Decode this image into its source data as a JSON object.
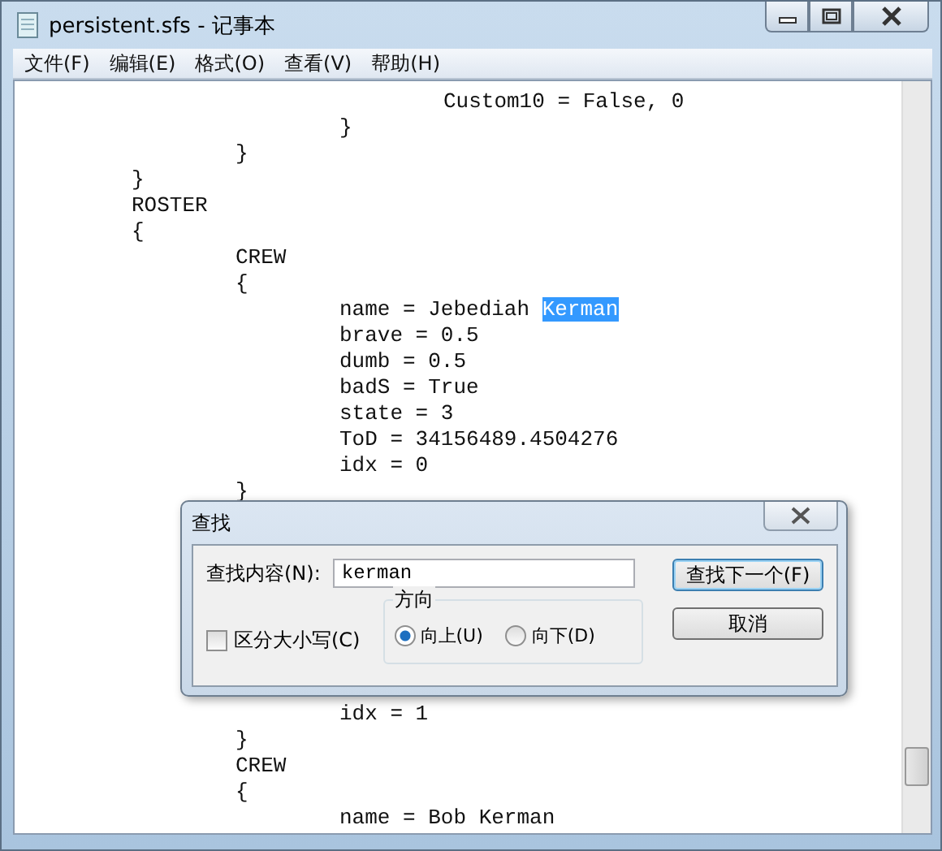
{
  "window": {
    "title": "persistent.sfs - 记事本"
  },
  "menu": [
    {
      "label": "文件(F)"
    },
    {
      "label": "编辑(E)"
    },
    {
      "label": "格式(O)"
    },
    {
      "label": "查看(V)"
    },
    {
      "label": "帮助(H)"
    }
  ],
  "editor": {
    "lines_top": [
      {
        "children": [
          {
            "children": [
              {
                "children": [
                  {
                    "text": "Custom10 = False, 0"
                  }
                ]
              },
              {
                "text": "}"
              }
            ]
          },
          {
            "text": "}"
          }
        ]
      },
      {
        "text": "}"
      },
      {
        "text": "ROSTER"
      },
      {
        "text": "{"
      },
      {
        "children": [
          {
            "text": "CREW"
          },
          {
            "text": "{"
          },
          {
            "children": [
              {
                "text": "name = Jebediah ",
                "selection": "Kerman"
              },
              {
                "text": "brave = 0.5"
              },
              {
                "text": "dumb = 0.5"
              },
              {
                "text": "badS = True"
              },
              {
                "text": "state = 3"
              },
              {
                "text": "ToD = 34156489.4504276"
              },
              {
                "text": "idx = 0"
              }
            ]
          },
          {
            "text": "}"
          }
        ]
      }
    ],
    "lines_bottom": [
      {
        "children": [
          {
            "children": [
              {
                "text": "idx = 1"
              }
            ]
          },
          {
            "text": "}"
          },
          {
            "text": "CREW"
          },
          {
            "text": "{"
          },
          {
            "children": [
              {
                "text": "name = Bob Kerman"
              }
            ]
          }
        ]
      }
    ]
  },
  "find_dialog": {
    "title": "查找",
    "find_label": "查找内容(N):",
    "find_value": "kerman",
    "match_case": {
      "label": "区分大小写(C)",
      "checked": false
    },
    "direction": {
      "label": "方向",
      "options": [
        {
          "label": "向上(U)",
          "selected": true
        },
        {
          "label": "向下(D)",
          "selected": false
        }
      ]
    },
    "buttons": [
      {
        "label": "查找下一个(F)",
        "default": true
      },
      {
        "label": "取消",
        "default": false
      }
    ]
  }
}
